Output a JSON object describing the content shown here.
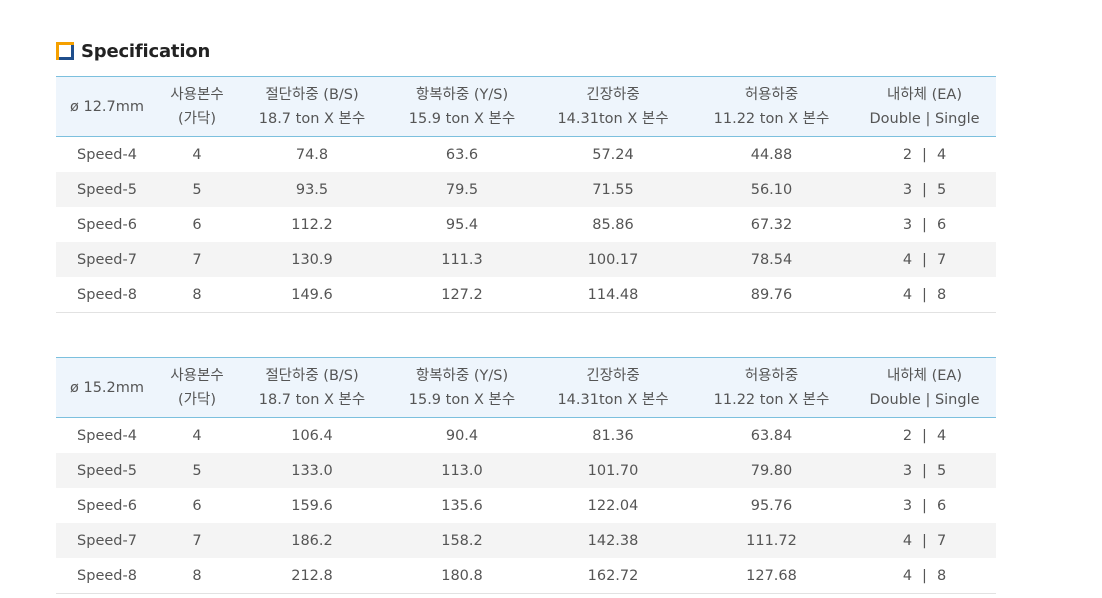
{
  "section": {
    "title": "Specification",
    "icon": "square-icon"
  },
  "headers": {
    "col2": [
      "사용본수",
      "(가닥)"
    ],
    "col3": [
      "절단하중 (B/S)",
      "18.7 ton X 본수"
    ],
    "col4": [
      "항복하중 (Y/S)",
      "15.9 ton X 본수"
    ],
    "col5": [
      "긴장하중",
      "14.31ton X 본수"
    ],
    "col6": [
      "허용하중",
      "11.22 ton X 본수"
    ],
    "col7": [
      "내하체 (EA)",
      "Double | Single"
    ]
  },
  "tables": [
    {
      "diameter": "ø 12.7mm",
      "rows": [
        {
          "name": "Speed-4",
          "count": "4",
          "bs": "74.8",
          "ys": "63.6",
          "tension": "57.24",
          "allow": "44.88",
          "double": "2",
          "single": "4"
        },
        {
          "name": "Speed-5",
          "count": "5",
          "bs": "93.5",
          "ys": "79.5",
          "tension": "71.55",
          "allow": "56.10",
          "double": "3",
          "single": "5"
        },
        {
          "name": "Speed-6",
          "count": "6",
          "bs": "112.2",
          "ys": "95.4",
          "tension": "85.86",
          "allow": "67.32",
          "double": "3",
          "single": "6"
        },
        {
          "name": "Speed-7",
          "count": "7",
          "bs": "130.9",
          "ys": "111.3",
          "tension": "100.17",
          "allow": "78.54",
          "double": "4",
          "single": "7"
        },
        {
          "name": "Speed-8",
          "count": "8",
          "bs": "149.6",
          "ys": "127.2",
          "tension": "114.48",
          "allow": "89.76",
          "double": "4",
          "single": "8"
        }
      ]
    },
    {
      "diameter": "ø 15.2mm",
      "rows": [
        {
          "name": "Speed-4",
          "count": "4",
          "bs": "106.4",
          "ys": "90.4",
          "tension": "81.36",
          "allow": "63.84",
          "double": "2",
          "single": "4"
        },
        {
          "name": "Speed-5",
          "count": "5",
          "bs": "133.0",
          "ys": "113.0",
          "tension": "101.70",
          "allow": "79.80",
          "double": "3",
          "single": "5"
        },
        {
          "name": "Speed-6",
          "count": "6",
          "bs": "159.6",
          "ys": "135.6",
          "tension": "122.04",
          "allow": "95.76",
          "double": "3",
          "single": "6"
        },
        {
          "name": "Speed-7",
          "count": "7",
          "bs": "186.2",
          "ys": "158.2",
          "tension": "142.38",
          "allow": "111.72",
          "double": "4",
          "single": "7"
        },
        {
          "name": "Speed-8",
          "count": "8",
          "bs": "212.8",
          "ys": "180.8",
          "tension": "162.72",
          "allow": "127.68",
          "double": "4",
          "single": "8"
        }
      ]
    }
  ],
  "colors": {
    "header_bg": "#eef5fc",
    "header_border": "#7cc0de",
    "stripe_bg": "#f4f4f4",
    "icon_blue": "#1f4e8c",
    "icon_orange": "#f5a000"
  }
}
